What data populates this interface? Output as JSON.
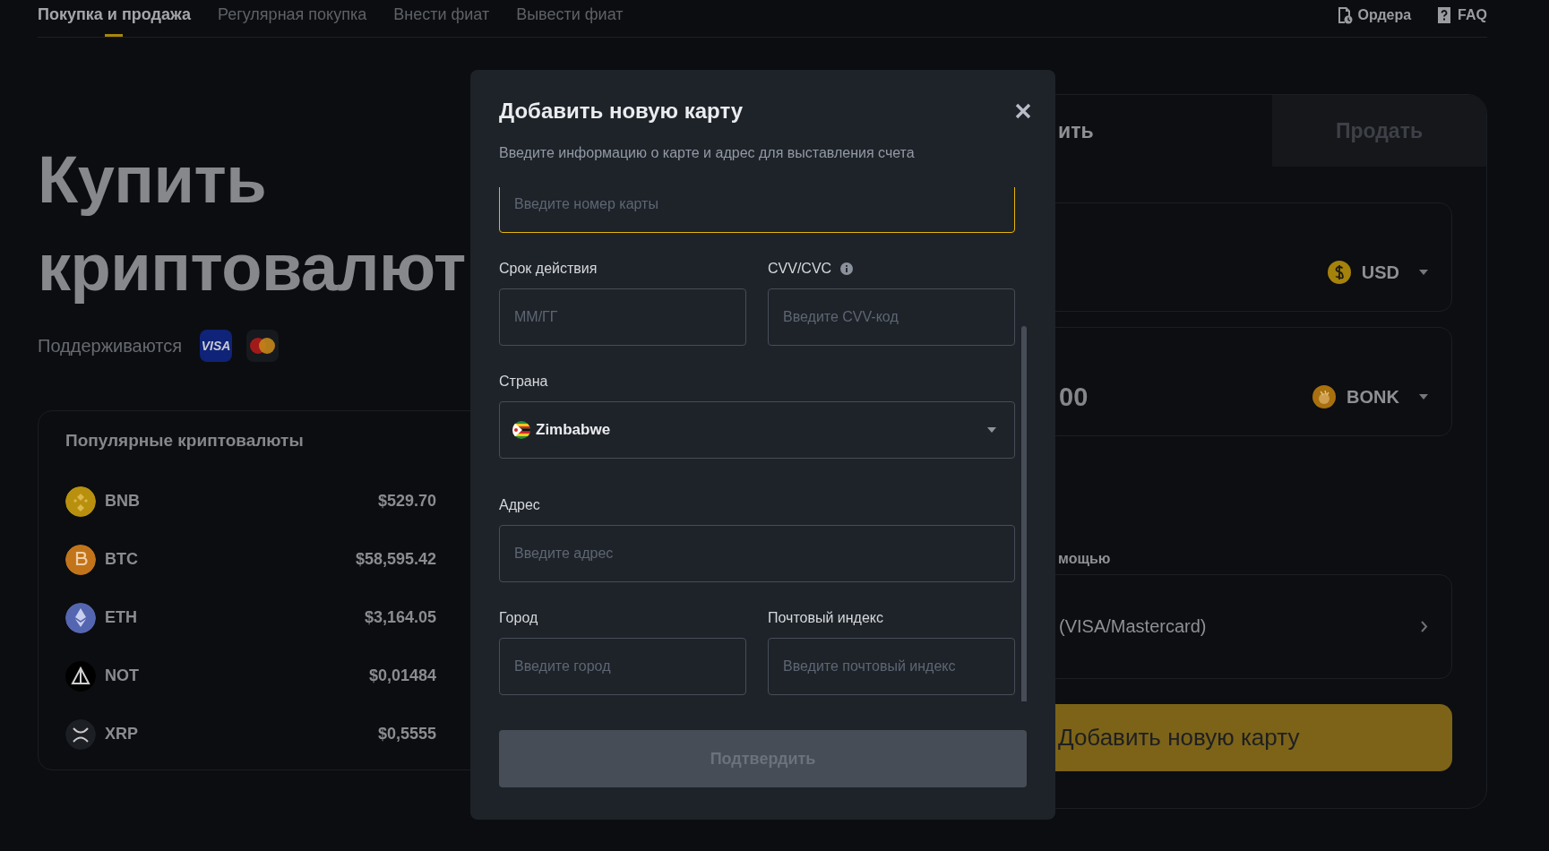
{
  "nav": {
    "tabs": [
      {
        "label": "Покупка и продажа",
        "selected": true
      },
      {
        "label": "Регулярная покупка",
        "selected": false
      },
      {
        "label": "Внести фиат",
        "selected": false
      },
      {
        "label": "Вывести фиат",
        "selected": false
      }
    ],
    "links": [
      {
        "kind": "orders",
        "label": "Ордера"
      },
      {
        "kind": "faq",
        "label": "FAQ"
      }
    ]
  },
  "hero": {
    "title_lines": [
      "Купить",
      "криптовалют"
    ],
    "supported_label": "Поддерживаются",
    "payment_logos": [
      {
        "kind": "visa",
        "text": "VISA"
      },
      {
        "kind": "mastercard"
      }
    ]
  },
  "popular": {
    "title": "Популярные криптовалюты",
    "coins": [
      {
        "kind": "bnb",
        "symbol": "BNB",
        "price": "$529.70",
        "color": "#b8900e"
      },
      {
        "kind": "btc",
        "symbol": "BTC",
        "price": "$58,595.42",
        "color": "#c2741a"
      },
      {
        "kind": "eth",
        "symbol": "ETH",
        "price": "$3,164.05",
        "color": "#5566b0"
      },
      {
        "kind": "not",
        "symbol": "NOT",
        "price": "$0,01484",
        "color": "#000000"
      },
      {
        "kind": "xrp",
        "symbol": "XRP",
        "price": "$0,5555",
        "color": "#1c1f24"
      }
    ]
  },
  "trade": {
    "tabs": [
      {
        "label": "ить",
        "selected": true
      },
      {
        "label": "Продать",
        "selected": false
      }
    ],
    "spend": {
      "currency": "USD"
    },
    "receive": {
      "amount": "00",
      "currency": "BONK"
    },
    "method_label": "мощью",
    "method": {
      "label": "(VISA/Mastercard)"
    },
    "action": "Добавить новую карту"
  },
  "modal": {
    "title": "Добавить новую карту",
    "subtitle": "Введите информацию о карте и адрес для выставления счета",
    "rows": [
      [
        {
          "kind": "input",
          "placeholder": "Введите номер карты",
          "focused": true
        }
      ],
      [
        {
          "kind": "input",
          "label": "Срок действия",
          "placeholder": "ММ/ГГ",
          "focused": false
        },
        {
          "kind": "input",
          "label": "CVV/CVC",
          "info": true,
          "placeholder": "Введите CVV-код",
          "focused": false
        }
      ],
      [
        {
          "kind": "select",
          "label": "Страна",
          "value": "Zimbabwe"
        }
      ],
      [
        {
          "kind": "input",
          "label": "Адрес",
          "placeholder": "Введите адрес",
          "focused": false
        }
      ],
      [
        {
          "kind": "input",
          "label": "Город",
          "placeholder": "Введите город",
          "focused": false
        },
        {
          "kind": "input",
          "label": "Почтовый индекс",
          "placeholder": "Введите почтовый индекс",
          "focused": false
        }
      ]
    ],
    "confirm": {
      "label": "Подтвердить",
      "disabled": true
    }
  }
}
